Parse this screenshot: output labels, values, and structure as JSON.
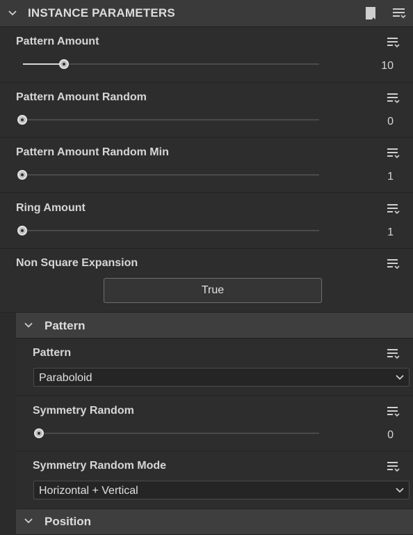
{
  "header": {
    "title": "INSTANCE PARAMETERS"
  },
  "params": [
    {
      "label": "Pattern Amount",
      "value": "10",
      "level": 0.14
    },
    {
      "label": "Pattern Amount Random",
      "value": "0",
      "level": 0
    },
    {
      "label": "Pattern Amount Random Min",
      "value": "1",
      "level": 0
    },
    {
      "label": "Ring Amount",
      "value": "1",
      "level": 0
    },
    {
      "label": "Non Square Expansion",
      "button": "True"
    }
  ],
  "pattern_section": {
    "title": "Pattern",
    "pattern": {
      "label": "Pattern",
      "selected": "Paraboloid"
    },
    "symmetry_random": {
      "label": "Symmetry Random",
      "value": "0",
      "level": 0
    },
    "symmetry_mode": {
      "label": "Symmetry Random Mode",
      "selected": "Horizontal + Vertical"
    }
  },
  "position_section": {
    "title": "Position"
  }
}
